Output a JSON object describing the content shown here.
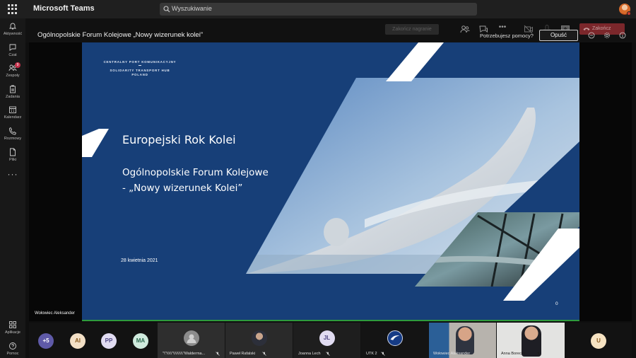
{
  "app": {
    "title": "Microsoft Teams"
  },
  "search": {
    "placeholder": "Wyszukiwanie"
  },
  "rail": {
    "items": [
      {
        "label": "Aktywność",
        "icon": "bell-icon"
      },
      {
        "label": "Czat",
        "icon": "chat-icon"
      },
      {
        "label": "Zespoły",
        "icon": "teams-icon",
        "badge": "9"
      },
      {
        "label": "Zadania",
        "icon": "assignments-icon"
      },
      {
        "label": "Kalendarz",
        "icon": "calendar-icon"
      },
      {
        "label": "Rozmowy",
        "icon": "phone-icon"
      },
      {
        "label": "Pliki",
        "icon": "files-icon"
      }
    ],
    "more": "···",
    "bottom": [
      {
        "label": "Aplikacje",
        "icon": "apps-icon"
      },
      {
        "label": "Pomoc",
        "icon": "help-icon"
      }
    ]
  },
  "meeting": {
    "title": "Ogólnopolskie Forum Kolejowe „Nowy wizerunek kolei”",
    "ghost_button": "Zakończ nagranie",
    "help_text": "Potrzebujesz pomocy?",
    "leave_label": "Opuść",
    "end_label": "Zakończ"
  },
  "slide": {
    "logo_line1": "CENTRALNY PORT KOMUNIKACYJNY",
    "logo_line2": "SOLIDARITY TRANSPORT HUB",
    "logo_line3": "POLAND",
    "heading": "Europejski Rok Kolei",
    "subtitle_line1": "Ogólnopolskie Forum Kolejowe",
    "subtitle_line2": "-  „Nowy wizerunek Kolei”",
    "date": "28 kwietnia 2021",
    "page_number": "0",
    "colors": {
      "background": "#173f78",
      "stripe": "#ffffff"
    }
  },
  "presenter": {
    "name": "Wołowiec Aleksander"
  },
  "participants": {
    "overflow": "+5",
    "initials": [
      {
        "initials": "AI",
        "color": "#f3e0c6"
      },
      {
        "initials": "PP",
        "color": "#e1dcf2"
      },
      {
        "initials": "MA",
        "color": "#cfeadd"
      }
    ],
    "tiles": [
      {
        "name": "\"\\\"\\\\\\\\\\\"\\\\\\\\\\\\\\\\\\\"Walderma...",
        "type": "avatar-generic"
      },
      {
        "name": "Paweł Rafalski",
        "type": "photo"
      },
      {
        "name": "Joanna Lech",
        "type": "initials",
        "initials": "JL"
      },
      {
        "name": "UTK 2",
        "type": "logo"
      },
      {
        "name": "Wołowiec Aleksander",
        "type": "video"
      },
      {
        "name": "Anna Borecka",
        "type": "video"
      }
    ],
    "last_initial": "U"
  }
}
